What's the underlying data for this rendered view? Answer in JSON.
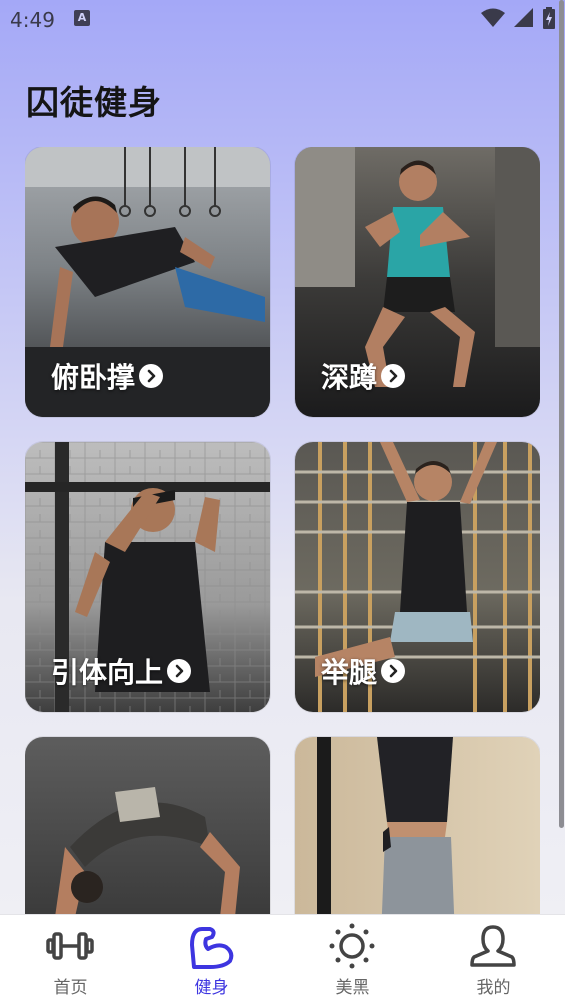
{
  "status_bar": {
    "time": "4:49",
    "notification_badge": "A"
  },
  "page": {
    "title": "囚徒健身"
  },
  "cards": [
    {
      "label": "俯卧撑",
      "image": "man-doing-one-arm-pushup-in-gym"
    },
    {
      "label": "深蹲",
      "image": "man-doing-squat-in-gym"
    },
    {
      "label": "引体向上",
      "image": "man-doing-pullup-at-brick-wall"
    },
    {
      "label": "举腿",
      "image": "man-doing-hanging-leg-raise-outdoors"
    },
    {
      "label": "",
      "image": "person-doing-bridge-pose"
    },
    {
      "label": "",
      "image": "person-doing-handstand-against-wall"
    }
  ],
  "tabbar": {
    "tabs": [
      {
        "label": "首页",
        "icon": "dumbbell-icon",
        "active": false
      },
      {
        "label": "健身",
        "icon": "flexed-arm-icon",
        "active": true
      },
      {
        "label": "美黑",
        "icon": "sun-icon",
        "active": false
      },
      {
        "label": "我的",
        "icon": "person-icon",
        "active": false
      }
    ]
  },
  "colors": {
    "accent": "#3d35e0",
    "background_top": "#a4a8f7",
    "background_bottom": "#f1f1f5"
  }
}
